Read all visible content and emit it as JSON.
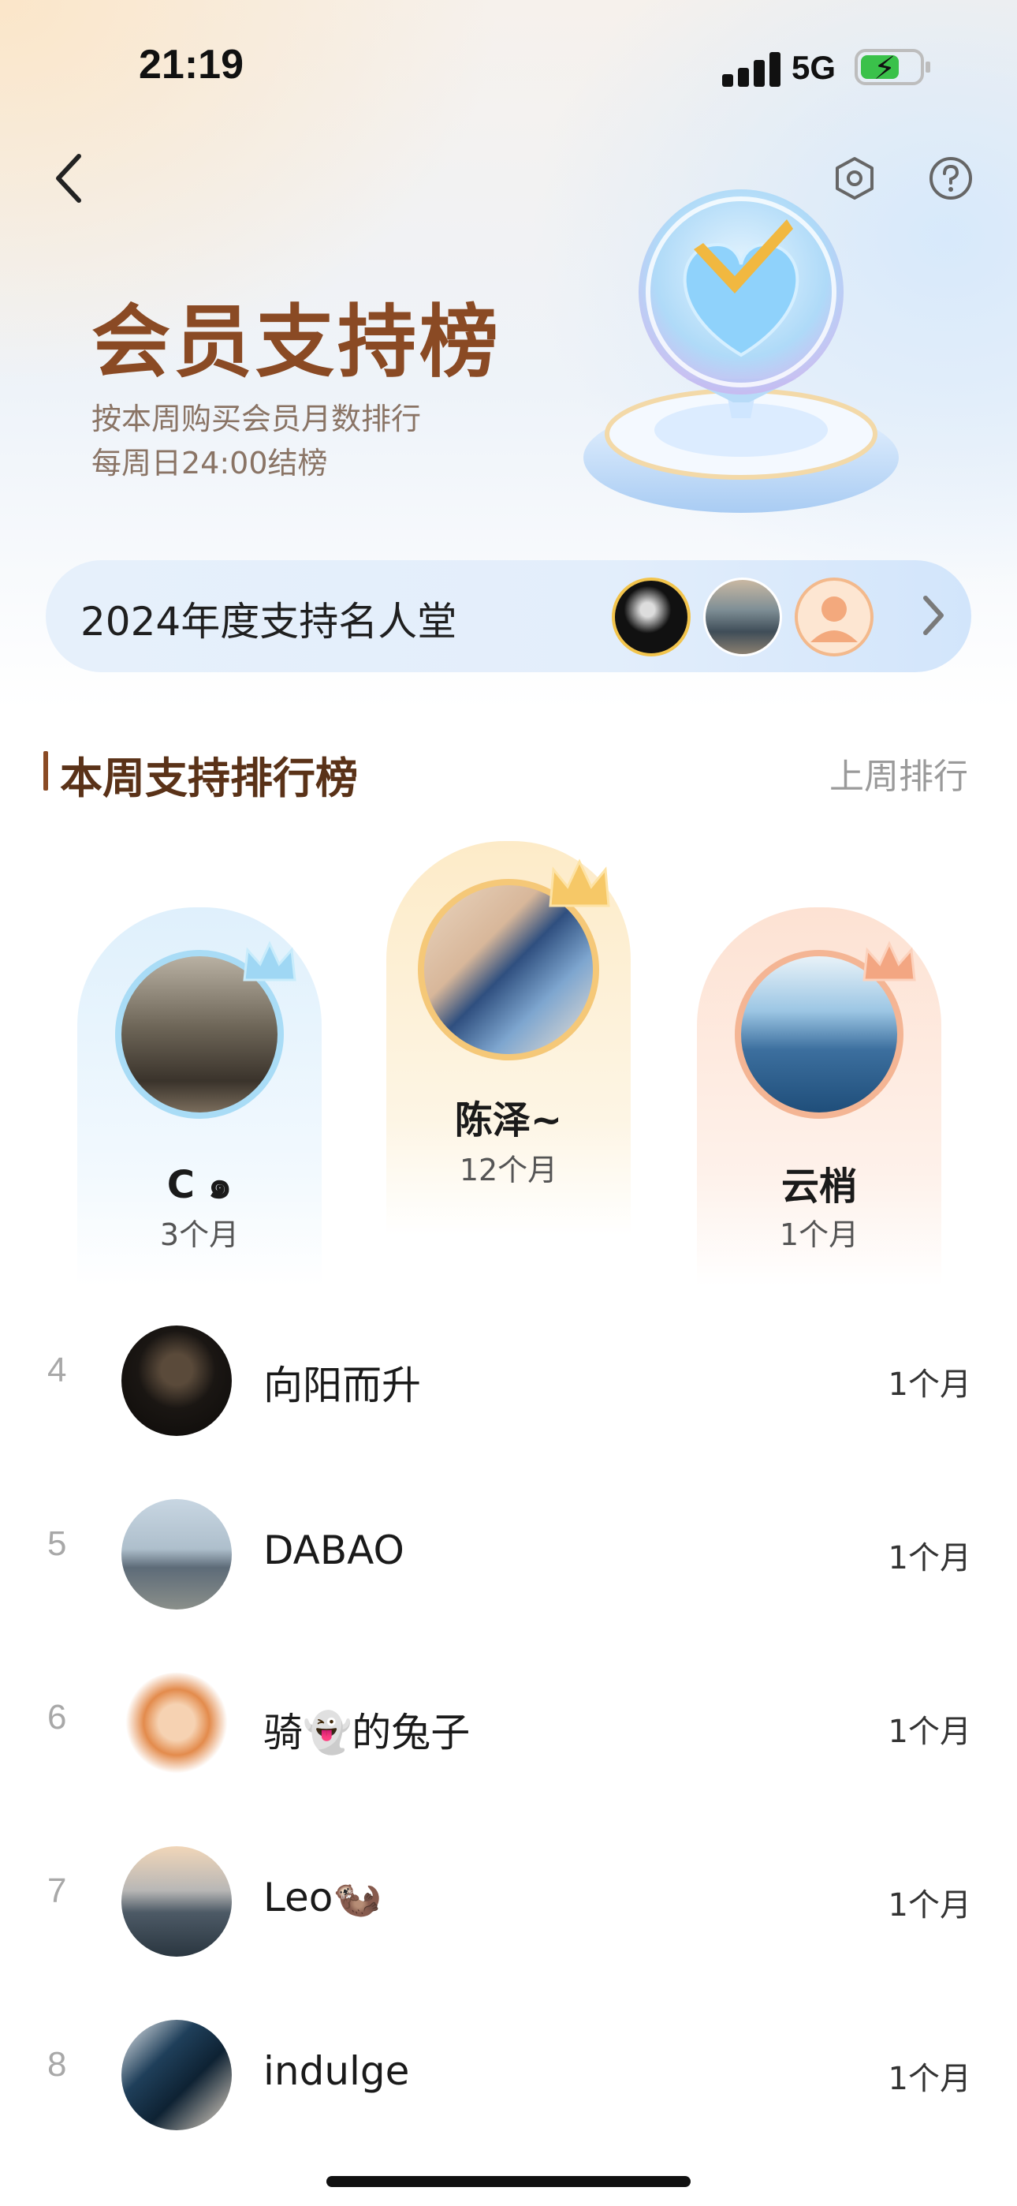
{
  "status_bar": {
    "time": "21:19",
    "network": "5G"
  },
  "header": {
    "title": "会员支持榜",
    "subtitle_1": "按本周购买会员月数排行",
    "subtitle_2": "每周日24:00结榜",
    "icons": [
      "back-icon",
      "hexagon-settings-icon",
      "help-icon"
    ]
  },
  "hall_of_fame": {
    "label": "2024年度支持名人堂"
  },
  "ranking": {
    "title": "本周支持排行榜",
    "last_week_link": "上周排行",
    "podium": [
      {
        "rank": 1,
        "name": "陈泽~",
        "months": "12个月",
        "color": "#f3c56a"
      },
      {
        "rank": 2,
        "name": "C ๑",
        "months": "3个月",
        "color": "#8ccaf0"
      },
      {
        "rank": 3,
        "name": "云梢",
        "months": "1个月",
        "color": "#f0a680"
      }
    ],
    "list": [
      {
        "rank": "4",
        "name": "向阳而升",
        "months": "1个月"
      },
      {
        "rank": "5",
        "name": "DABAO",
        "months": "1个月"
      },
      {
        "rank": "6",
        "name": "骑👻的兔子",
        "months": "1个月"
      },
      {
        "rank": "7",
        "name": "Leo🦦",
        "months": "1个月"
      },
      {
        "rank": "8",
        "name": "indulge",
        "months": "1个月"
      }
    ]
  },
  "colors": {
    "title_brown": "#8a4a24",
    "gold": "#f3c56a",
    "silver_blue": "#8ccaf0",
    "bronze": "#f0a680"
  }
}
